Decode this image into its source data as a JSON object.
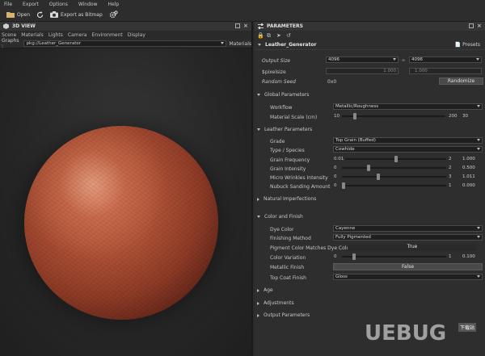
{
  "menu": [
    "File",
    "Export",
    "Options",
    "Window",
    "Help"
  ],
  "toolbar": {
    "open": "Open",
    "export": "Export as Bitmap"
  },
  "view3d": {
    "title": "3D VIEW",
    "tabs": [
      "Scene",
      "Materials",
      "Lights",
      "Camera",
      "Environment",
      "Display"
    ],
    "graphs_label": "Graphs :",
    "graph_value": "pkg://Leather_Generator",
    "materials_label": "Materials"
  },
  "params": {
    "title": "PARAMETERS",
    "graph_name": "Leather_Generator",
    "presets": "Presets",
    "output_size_label": "Output Size",
    "output_w": "4096",
    "output_h": "4096",
    "pixelsize_label": "$pixelsize",
    "pixelsize_a": "1.000",
    "pixelsize_b": "1.000",
    "random_seed_label": "Random Seed",
    "random_seed_value": "0x0",
    "randomize": "Randomize",
    "global_params": "Global Parameters",
    "workflow_label": "Workflow",
    "workflow_value": "Metallic/Roughness",
    "mat_scale_label": "Material Scale (cm)",
    "mat_scale_min": "10",
    "mat_scale_max": "200",
    "mat_scale_value": "30",
    "leather_params": "Leather Parameters",
    "grade_label": "Grade",
    "grade_value": "Top Grain (Buffed)",
    "type_label": "Type / Species",
    "type_value": "Cowhide",
    "grain_freq_label": "Grain Frequency",
    "grain_freq_min": "0.01",
    "grain_freq_max": "2",
    "grain_freq_value": "1.000",
    "grain_int_label": "Grain Intensity",
    "grain_int_min": "0",
    "grain_int_max": "2",
    "grain_int_value": "0.500",
    "micro_label": "Micro Wrinkles Intensity",
    "micro_min": "0",
    "micro_max": "3",
    "micro_value": "1.011",
    "nubuck_label": "Nubuck Sanding Amount",
    "nubuck_min": "0",
    "nubuck_max": "1",
    "nubuck_value": "0.000",
    "natural_imperf": "Natural Imperfections",
    "color_finish": "Color and Finish",
    "dye_label": "Dye Color",
    "dye_value": "Cayenne",
    "finishing_label": "Finishing Method",
    "finishing_value": "Fully Pigmented",
    "pigment_label": "Pigment Color Matches Dye Color?",
    "pigment_value": "True",
    "colvar_label": "Color Variation",
    "colvar_min": "0",
    "colvar_max": "1",
    "colvar_value": "0.100",
    "metallic_label": "Metallic Finish",
    "metallic_value": "False",
    "topcoat_label": "Top Coat Finish",
    "topcoat_value": "Gloss",
    "age": "Age",
    "adjustments": "Adjustments",
    "output_params": "Output Parameters"
  },
  "sliders": {
    "mat_scale": 0.11,
    "grain_freq": 0.5,
    "grain_int": 0.25,
    "micro": 0.34,
    "nubuck": 0.0,
    "colvar": 0.1
  },
  "watermark": {
    "logo": "UEBUG",
    "badge": "下载站"
  },
  "colors": {
    "sphere": "#b25438",
    "panel": "#2e2e2e"
  }
}
